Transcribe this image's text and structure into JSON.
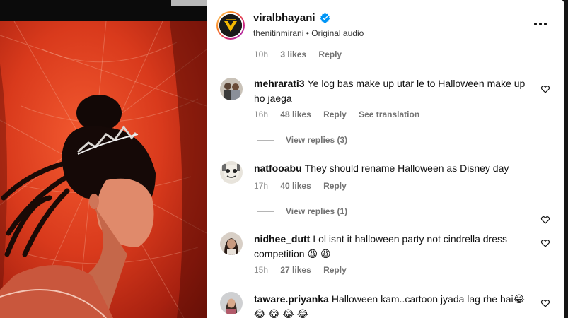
{
  "post": {
    "username": "viralbhayani",
    "subtitle": "thenitinmirani • Original audio"
  },
  "partial_comment": {
    "time": "10h",
    "likes": "3 likes",
    "reply": "Reply"
  },
  "comments": [
    {
      "username": "mehrarati3",
      "text": "Ye log bas make up utar le to Halloween make up ho jaega",
      "time": "16h",
      "likes": "48 likes",
      "reply": "Reply",
      "translate": "See translation",
      "view_replies": "View replies (3)"
    },
    {
      "username": "natfooabu",
      "text": "They should rename Halloween as Disney day",
      "time": "17h",
      "likes": "40 likes",
      "reply": "Reply",
      "view_replies": "View replies (1)"
    },
    {
      "username": "nidhee_dutt",
      "text": "Lol isnt it halloween party not cindrella dress competition 😩 😩",
      "time": "15h",
      "likes": "27 likes",
      "reply": "Reply"
    },
    {
      "username": "taware.priyanka",
      "text": "Halloween kam..cartoon jyada lag rhe hai😂 😂 😂 😂 😂"
    }
  ],
  "icons": {
    "verified": "verified-badge-icon",
    "more": "more-options-icon",
    "like": "heart-icon"
  },
  "colors": {
    "verified_blue": "#0095f6",
    "meta_gray": "#8e8e8e",
    "video_red": "#d93a1c"
  }
}
